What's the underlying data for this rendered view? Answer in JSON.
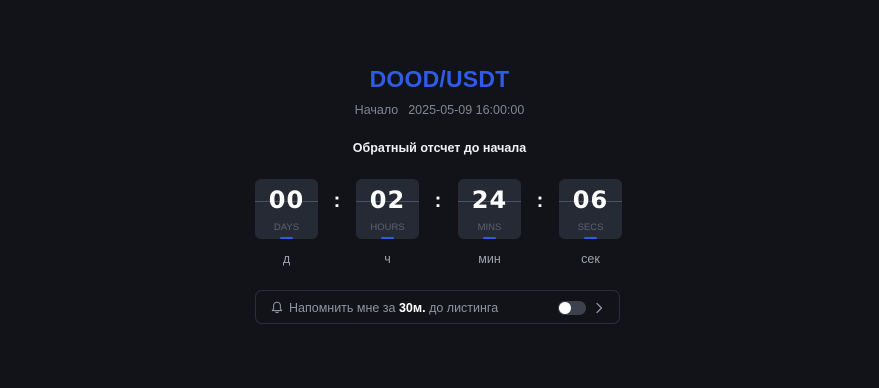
{
  "listing": {
    "pair": "DOOD/USDT",
    "start_label": "Начало",
    "start_time": "2025-05-09 16:00:00"
  },
  "countdown": {
    "title": "Обратный отсчет до начала",
    "units": [
      {
        "value": "00",
        "unit": "DAYS",
        "label": "д"
      },
      {
        "value": "02",
        "unit": "HOURS",
        "label": "ч"
      },
      {
        "value": "24",
        "unit": "MINS",
        "label": "мин"
      },
      {
        "value": "06",
        "unit": "SECS",
        "label": "сек"
      }
    ],
    "separator": ":"
  },
  "reminder": {
    "text_before": "Напомнить мне за ",
    "time": "30м.",
    "text_after": " до листинга",
    "enabled": false,
    "icon": "bell-icon",
    "arrow_icon": "chevron-right-icon"
  },
  "colors": {
    "background": "#121318",
    "accent": "#2f5be8",
    "tile": "#262a35"
  }
}
